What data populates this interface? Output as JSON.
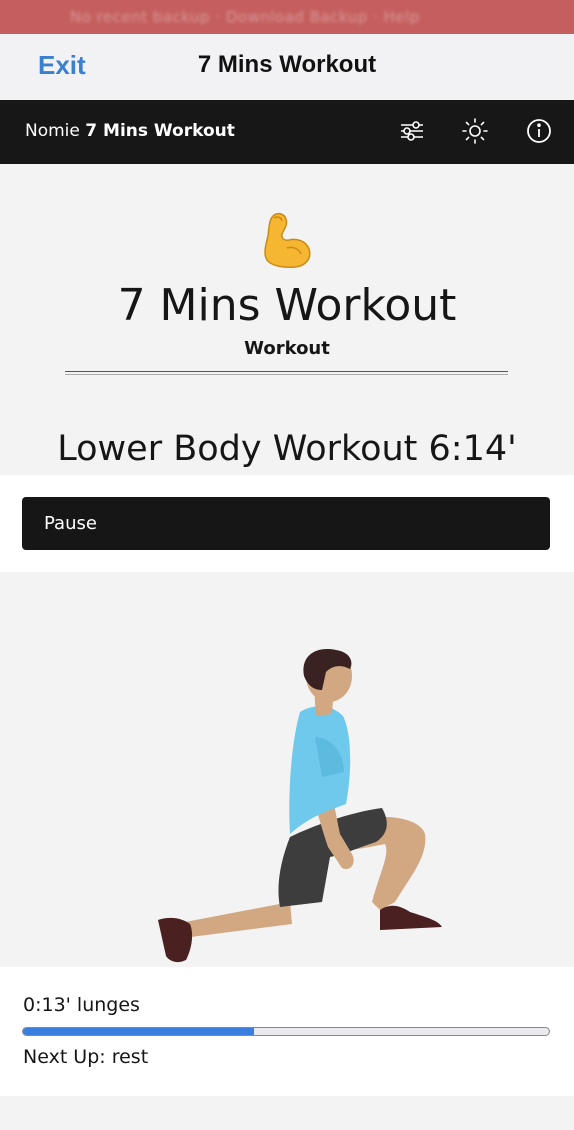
{
  "browser_bar": {
    "text": "No recent backup · Download Backup · Help"
  },
  "header": {
    "exit_label": "Exit",
    "title": "7 Mins Workout"
  },
  "app_bar": {
    "brand": "Nomie",
    "tracker_name": "7 Mins Workout"
  },
  "tracker": {
    "emoji": "💪",
    "title": "7 Mins Workout",
    "subtitle": "Workout"
  },
  "workout": {
    "name_time": "Lower Body Workout 6:14'",
    "pause_label": "Pause",
    "current_exercise": "0:13' lunges",
    "progress_fraction": 0.44,
    "next_up": "Next Up: rest"
  },
  "colors": {
    "accent": "#3a7fd0",
    "progress": "#3a7ee0",
    "dark_bar": "#171717",
    "top_bar": "#c55f5f"
  },
  "icons": [
    "sliders-icon",
    "sun-icon",
    "info-icon"
  ]
}
